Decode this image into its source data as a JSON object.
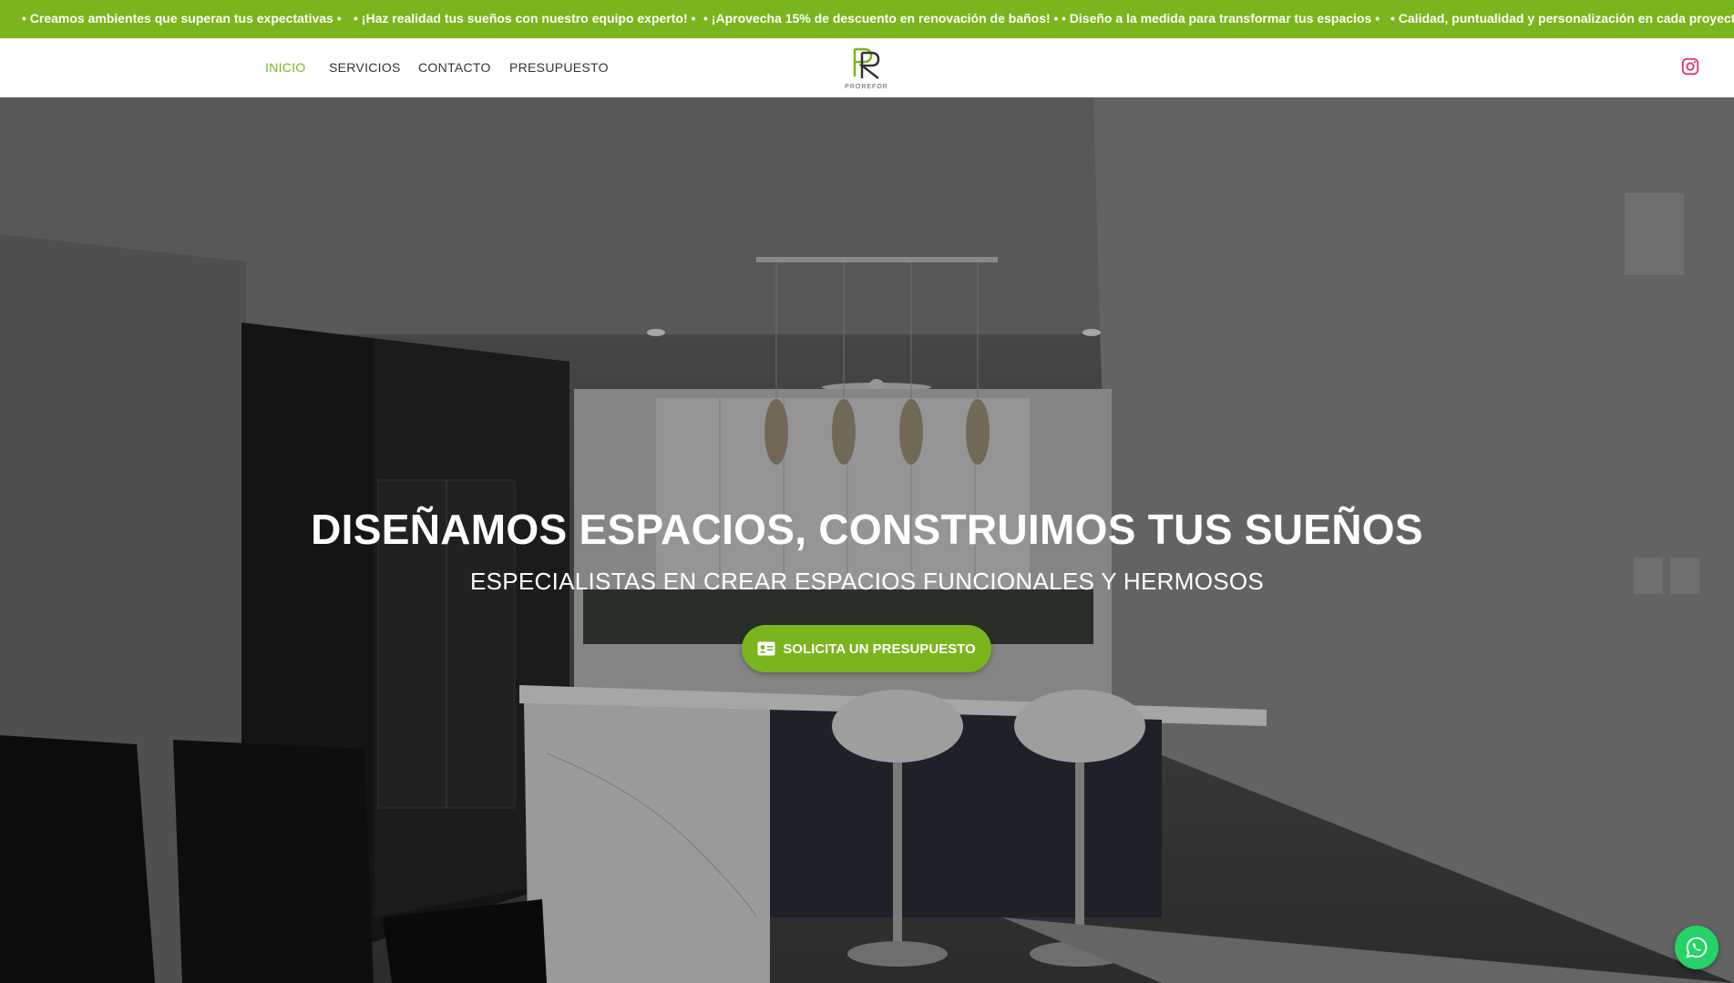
{
  "ticker": {
    "items": [
      "• Creamos ambientes que superan tus expectativas •",
      "• ¡Haz realidad tus sueños con nuestro equipo experto! •",
      "• ¡Aprovecha 15% de descuento en renovación de baños! •",
      "• Diseño a la medida para transformar tus espacios •",
      "• Calidad, puntualidad y personalización en cada proyecto •"
    ]
  },
  "nav": {
    "links": [
      "INICIO",
      "SERVICIOS",
      "CONTACTO",
      "PRESUPUESTO"
    ],
    "active": "INICIO",
    "logo_text": "PROREFOR",
    "logo_mark": "PR"
  },
  "hero": {
    "title": "DISEÑAMOS ESPACIOS, CONSTRUIMOS TUS SUEÑOS",
    "subtitle": "ESPECIALISTAS EN CREAR ESPACIOS FUNCIONALES Y HERMOSOS",
    "cta_label": "SOLICITA UN PRESUPUESTO"
  },
  "colors": {
    "brand_green": "#7ab51d",
    "whatsapp_green": "#25d366",
    "instagram": "#e1306c"
  },
  "icons": {
    "social": "instagram-icon",
    "cta": "id-card-icon",
    "chat": "whatsapp-icon"
  }
}
